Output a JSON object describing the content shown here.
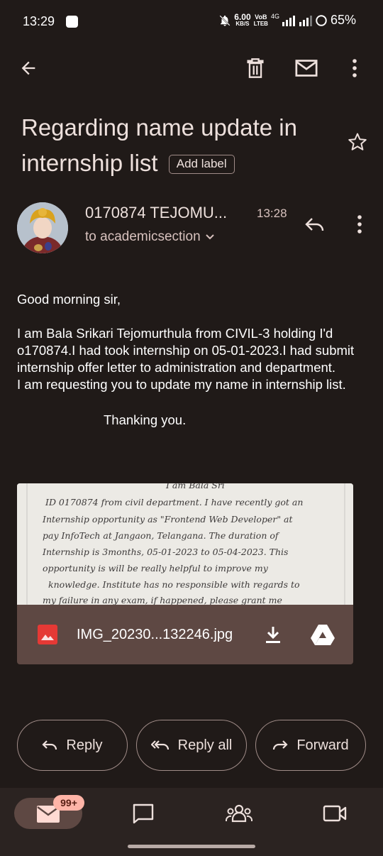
{
  "status_bar": {
    "time": "13:29",
    "net_speed_value": "6.00",
    "net_speed_unit": "KB/S",
    "volte_top": "VoB",
    "volte_bottom": "LTEB",
    "network": "4G",
    "battery": "65%"
  },
  "toolbar": {
    "back": "arrow-left-icon",
    "delete": "trash-icon",
    "mark_unread": "mail-icon",
    "more": "more-vert-icon"
  },
  "email": {
    "subject": "Regarding name update in internship list",
    "add_label": "Add label",
    "sender": "0170874 TEJOMU...",
    "time": "13:28",
    "recipient": "to academicsection",
    "greeting": "Good morning sir,",
    "body_1": "I am Bala Srikari Tejomurthula from CIVIL-3 holding I'd o170874.I had took internship on 05-01-2023.I had submit internship offer letter to administration and department.",
    "body_2": "I am requesting you to update my name in internship list.",
    "closing": "Thanking you."
  },
  "attachment": {
    "filename": "IMG_20230...132246.jpg",
    "handwriting_lines": [
      "ID 0170874 from civil department. I have recently got an",
      "Internship opportunity as \"Frontend Web Developer\" at",
      "pay InfoTech at Jangaon, Telangana. The duration of",
      "Internship is 3months, 05-01-2023 to 05-04-2023. This",
      "opportunity is will be really helpful to improve my",
      "knowledge. Institute has no responsible with regards to",
      "my failure in any exam, if happened, please grant me"
    ]
  },
  "actions": {
    "reply": "Reply",
    "reply_all": "Reply all",
    "forward": "Forward"
  },
  "bottom_nav": {
    "mail_badge": "99+",
    "items": [
      "mail-icon",
      "chat-icon",
      "spaces-icon",
      "meet-icon"
    ]
  },
  "colors": {
    "background": "#201a18",
    "attachment_bar": "#5e4843",
    "badge": "#ffb4a7"
  }
}
